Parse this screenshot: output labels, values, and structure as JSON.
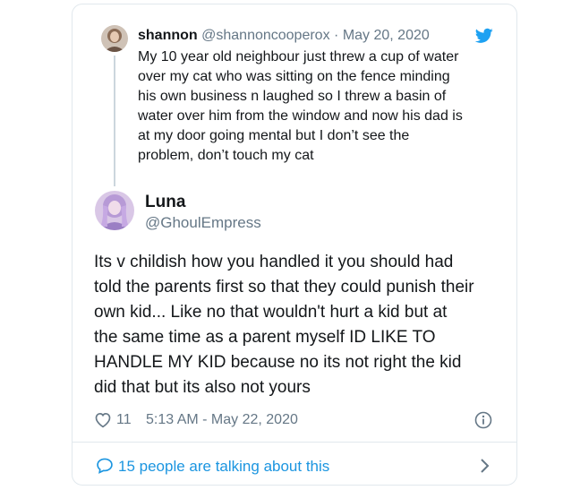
{
  "parent_tweet": {
    "display_name": "shannon",
    "handle": "@shannoncooperox",
    "separator": "·",
    "date": "May 20, 2020",
    "text": "My 10 year old neighbour just threw a cup of water\nover my cat who was sitting on the fence minding\nhis own business n laughed so I threw a basin of\nwater over him from the window and now his dad is\nat my door going mental but I don’t see the\nproblem, don’t touch my cat"
  },
  "main_tweet": {
    "display_name": "Luna",
    "handle": "@GhoulEmpress",
    "text": "Its v childish how you handled it you should had\ntold the parents first so that they could punish their\nown kid... Like no that wouldn't hurt a kid but at\nthe same time as a parent myself ID LIKE TO\nHANDLE MY KID because no its not right the kid\ndid that but its also not yours",
    "like_count": "11",
    "timestamp": "5:13 AM - May 22, 2020"
  },
  "footer": {
    "talking_text": "15 people are talking about this"
  },
  "icons": {
    "brand": "twitter-bird-icon",
    "like": "heart-icon",
    "info": "info-icon",
    "reply": "speech-bubble-icon",
    "more": "chevron-right-icon"
  },
  "colors": {
    "twitter_blue": "#1da1f2",
    "link_blue": "#1b95e0",
    "secondary_text": "#657786",
    "border": "#e1e8ed"
  }
}
